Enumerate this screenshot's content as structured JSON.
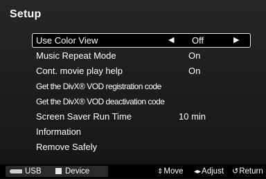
{
  "screen": {
    "title": "Setup"
  },
  "menu": {
    "items": [
      {
        "label": "Use Color View",
        "value": "Off"
      },
      {
        "label": "Music Repeat Mode",
        "value": "On"
      },
      {
        "label": "Cont. movie play help",
        "value": "On"
      },
      {
        "label": "Get the DivX® VOD registration code",
        "value": ""
      },
      {
        "label": "Get the DivX® VOD deactivation code",
        "value": ""
      },
      {
        "label": "Screen Saver Run Time",
        "value": "10 min"
      },
      {
        "label": "Information",
        "value": ""
      },
      {
        "label": "Remove Safely",
        "value": ""
      }
    ],
    "selected_index": 0
  },
  "footer": {
    "usb_label": "USB",
    "device_label": "Device",
    "move_label": "Move",
    "adjust_label": "Adjust",
    "return_label": "Return",
    "icons": [
      "usb-icon",
      "device-icon",
      "updown-icon",
      "leftright-icon",
      "return-icon"
    ]
  },
  "colors": {
    "background": "#1c1c1c",
    "footer_background": "#000000",
    "selection_border": "#e8e8e8",
    "text": "#ffffff"
  }
}
